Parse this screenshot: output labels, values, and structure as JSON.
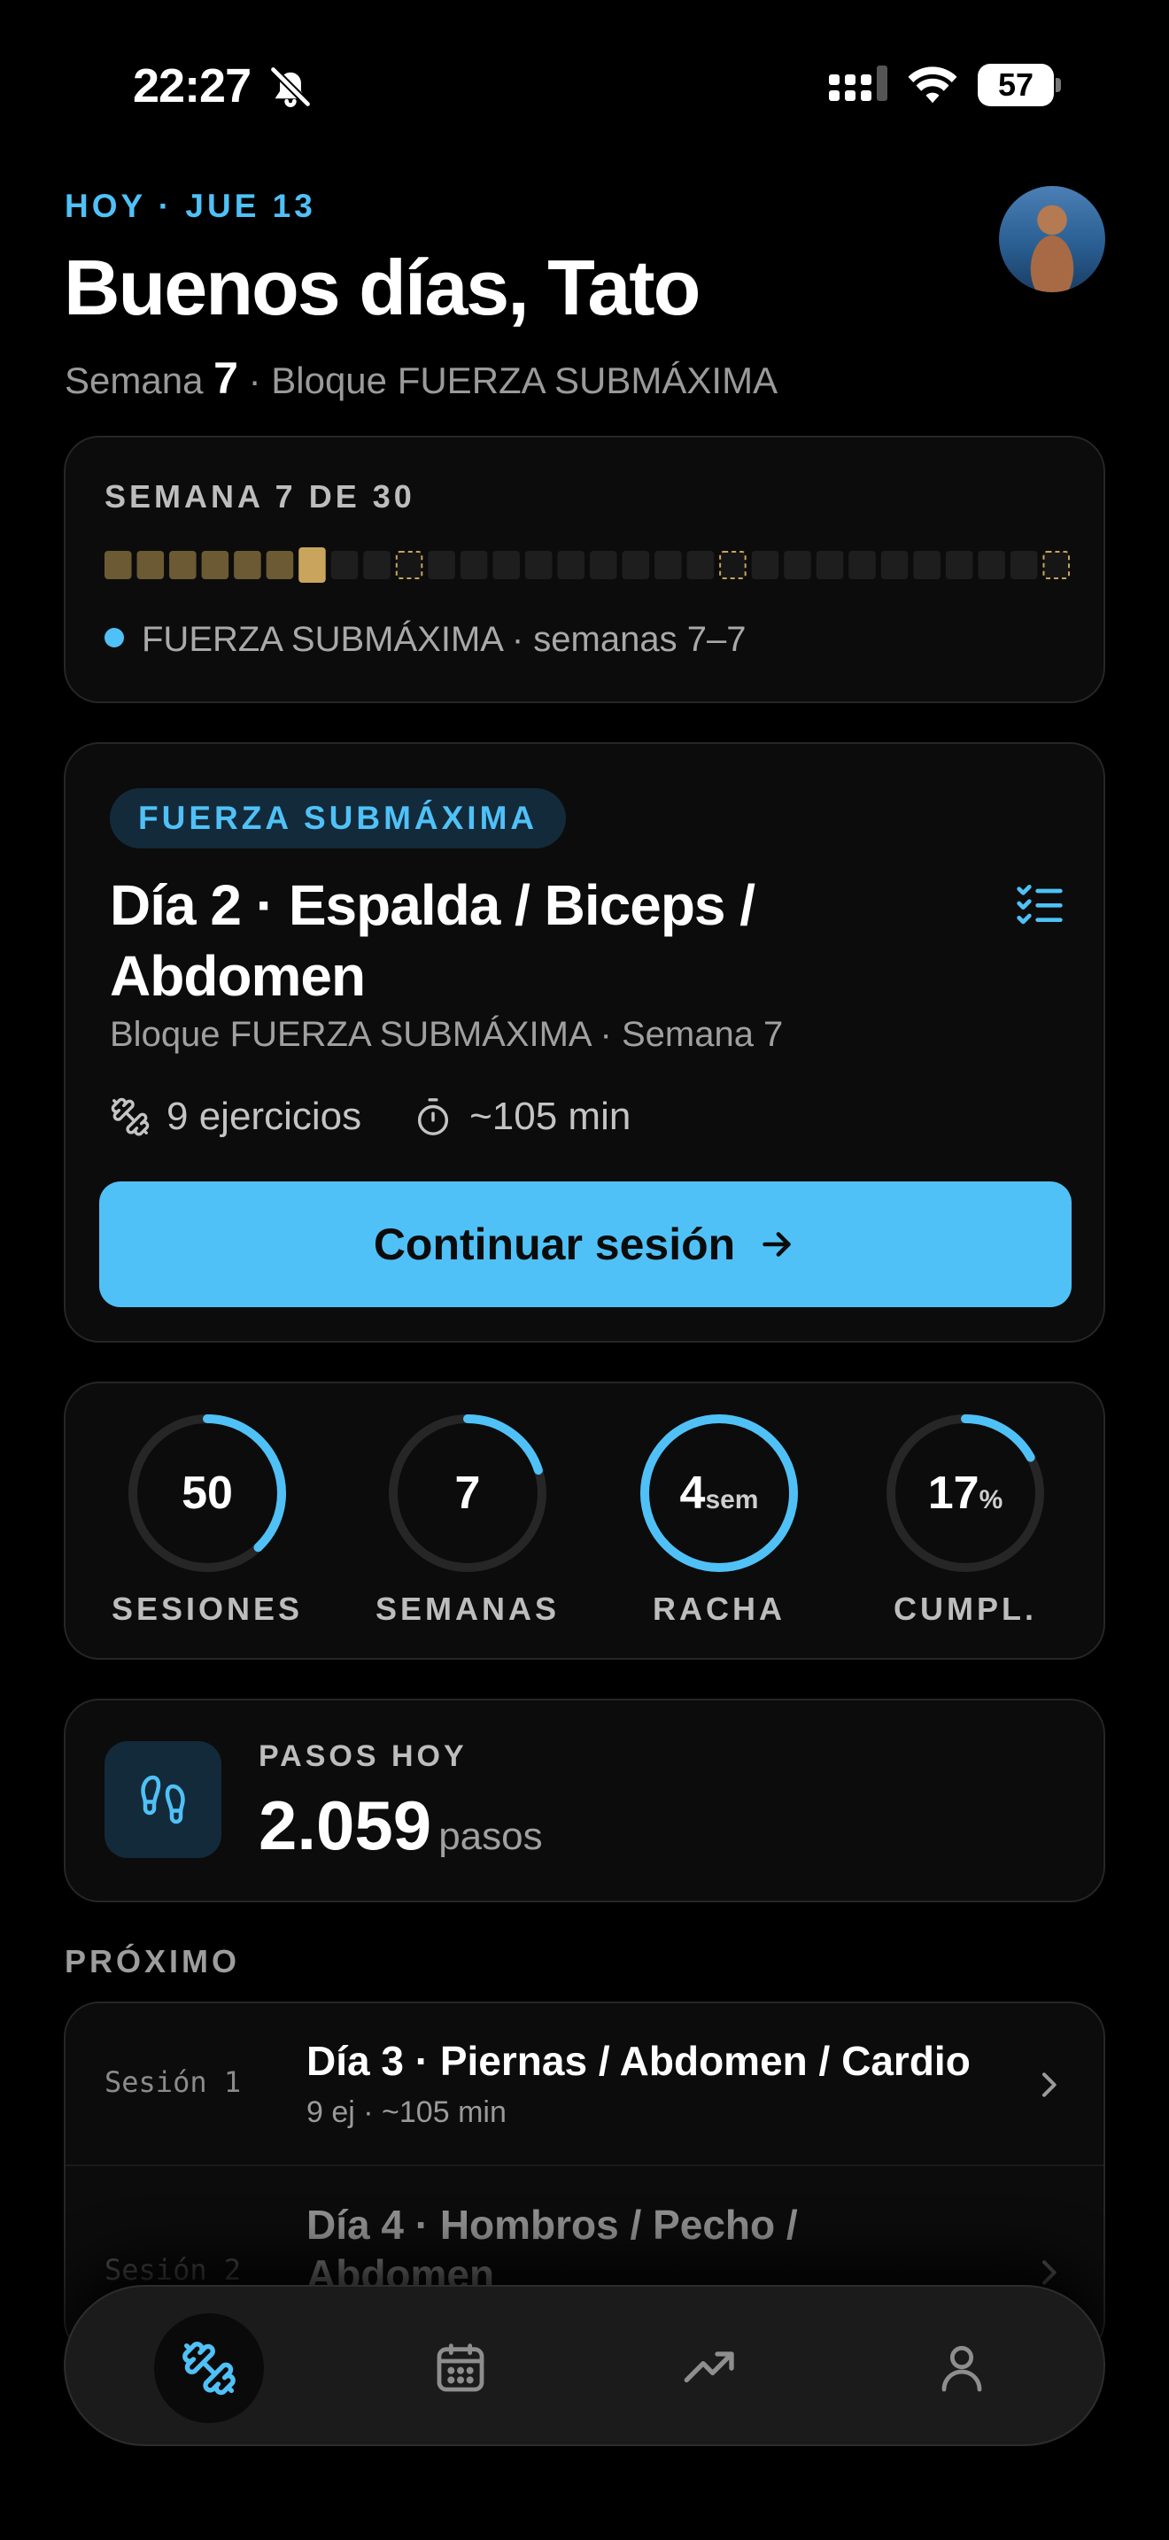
{
  "status_bar": {
    "time": "22:27",
    "battery": "57",
    "icons": [
      "bell-slash-icon",
      "signal-icon",
      "wifi-icon",
      "battery-icon"
    ]
  },
  "header": {
    "eyebrow": "HOY · JUE 13",
    "greeting": "Buenos días, Tato",
    "week_prefix": "Semana",
    "week_number": "7",
    "block_suffix": "· Bloque FUERZA SUBMÁXIMA"
  },
  "week_card": {
    "title": "SEMANA 7 DE 30",
    "total_weeks": 30,
    "completed_weeks": 6,
    "current_week": 7,
    "deload_weeks": [
      10,
      20,
      30
    ],
    "legend": "FUERZA SUBMÁXIMA · semanas 7–7"
  },
  "session_card": {
    "badge": "FUERZA SUBMÁXIMA",
    "title": "Día 2 · Espalda / Biceps / Abdomen",
    "subtitle": "Bloque FUERZA SUBMÁXIMA · Semana 7",
    "exercises": "9 ejercicios",
    "duration": "~105 min",
    "cta": "Continuar sesión"
  },
  "stats": [
    {
      "value": "50",
      "unit": "",
      "label": "SESIONES",
      "progress": 0.38
    },
    {
      "value": "7",
      "unit": "",
      "label": "SEMANAS",
      "progress": 0.2
    },
    {
      "value": "4",
      "unit": "sem",
      "label": "RACHA",
      "progress": 1.0
    },
    {
      "value": "17",
      "unit": "%",
      "label": "CUMPL.",
      "progress": 0.17
    }
  ],
  "steps": {
    "label": "PASOS HOY",
    "value": "2.059",
    "unit": "pasos"
  },
  "upcoming": {
    "section": "PRÓXIMO",
    "items": [
      {
        "tag": "Sesión 1",
        "title": "Día 3 · Piernas / Abdomen / Cardio",
        "subtitle": "9 ej · ~105 min"
      },
      {
        "tag": "Sesión 2",
        "title": "Día 4 · Hombros / Pecho / Abdomen",
        "subtitle": ""
      }
    ]
  },
  "tabs": [
    "dumbbell-icon",
    "calendar-icon",
    "trend-icon",
    "profile-icon"
  ],
  "colors": {
    "accent": "#4fc1f7",
    "gold": "#c9a45c",
    "background": "#000000",
    "card": "#0c0c0c"
  }
}
